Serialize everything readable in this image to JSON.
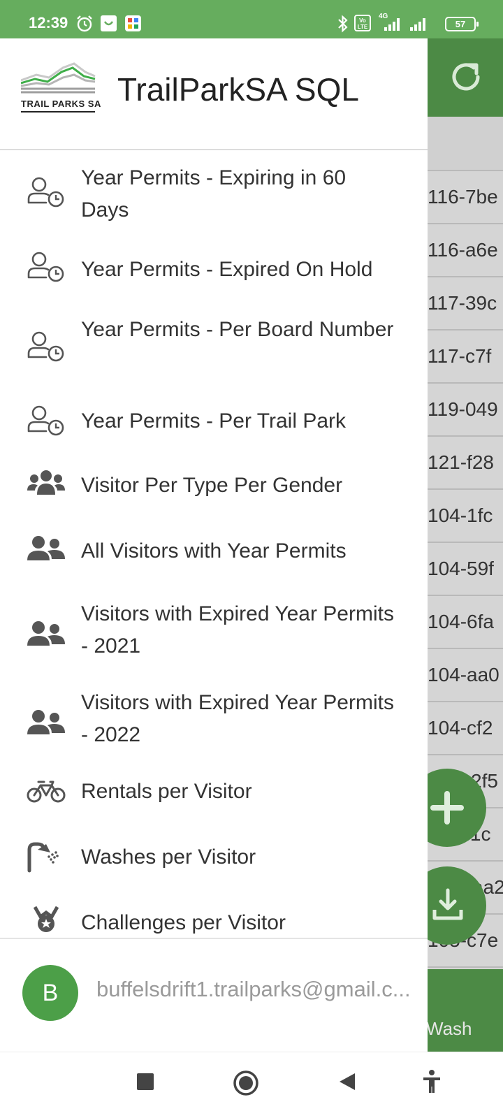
{
  "status_bar": {
    "time": "12:39",
    "battery": "57",
    "volte_label": "Vo LTE",
    "network_label": "4G",
    "icons": [
      "alarm-icon",
      "app-notification-icon",
      "app-notification-icon-2",
      "bluetooth-icon",
      "volte-icon",
      "signal-icon",
      "signal-icon-2",
      "battery-icon"
    ]
  },
  "drawer": {
    "logo_text": "TRAIL PARKS SA",
    "title": "TrailParkSA SQL",
    "items": [
      {
        "label": "Year Permits - Expiring in 60 Days",
        "icon": "user-clock-icon"
      },
      {
        "label": "Year Permits - Expired On Hold",
        "icon": "user-clock-icon"
      },
      {
        "label": "Year Permits - Per Board Number",
        "icon": "user-clock-icon"
      },
      {
        "label": "Year Permits - Per Trail Park",
        "icon": "user-clock-icon"
      },
      {
        "label": "Visitor Per Type Per Gender",
        "icon": "users-group-icon"
      },
      {
        "label": "All Visitors with Year Permits",
        "icon": "user-friends-icon"
      },
      {
        "label": "Visitors with Expired Year Permits - 2021",
        "icon": "user-friends-icon"
      },
      {
        "label": "Visitors with Expired Year Permits - 2022",
        "icon": "user-friends-icon"
      },
      {
        "label": "Rentals per Visitor",
        "icon": "bicycle-icon"
      },
      {
        "label": "Washes per Visitor",
        "icon": "shower-icon"
      },
      {
        "label": "Challenges per Visitor",
        "icon": "medal-icon"
      }
    ],
    "account": {
      "avatar_letter": "B",
      "email": "buffelsdrift1.trailparks@gmail.c..."
    }
  },
  "background_app": {
    "rows": [
      "116-7be",
      "116-a6e",
      "117-39c",
      "117-c7f",
      "119-049",
      "121-f28",
      "104-1fc",
      "104-59f",
      "104-6fa",
      "104-aa0",
      "104-cf2",
      "2f5",
      "-51c",
      "aa2",
      "105-c7e"
    ],
    "bottom_tab_label": "Wash"
  },
  "colors": {
    "brand_green": "#66ad5e",
    "dark_green": "#4c8a45",
    "avatar_green": "#4c9f48"
  }
}
